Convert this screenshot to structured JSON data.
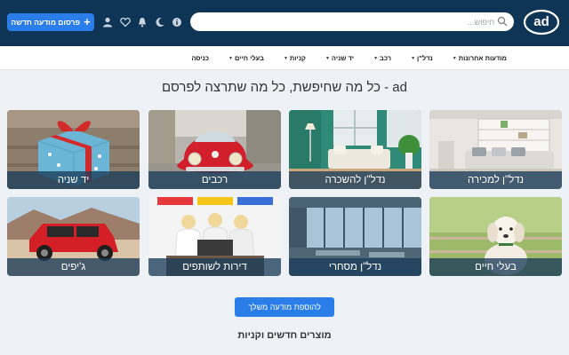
{
  "header": {
    "logo_text": "ad",
    "search_placeholder": "חיפוש...",
    "publish_label": "פרסום מודעה חדשה",
    "publish_icon": "plus-icon",
    "icons": [
      "info-icon",
      "moon-icon",
      "bell-icon",
      "heart-icon",
      "user-icon"
    ]
  },
  "nav": {
    "items": [
      {
        "label": "מודעות אחרונות",
        "dropdown": true
      },
      {
        "label": "נדל\"ן",
        "dropdown": true
      },
      {
        "label": "רכב",
        "dropdown": true
      },
      {
        "label": "יד שניה",
        "dropdown": true
      },
      {
        "label": "קניות",
        "dropdown": true
      },
      {
        "label": "בעלי חיים",
        "dropdown": true
      },
      {
        "label": "כניסה",
        "dropdown": false
      }
    ]
  },
  "main": {
    "headline": "ad - כל מה שחיפשת, כל מה שתרצה לפרסם",
    "categories": [
      {
        "label": "נדל\"ן למכירה",
        "image": "living-room"
      },
      {
        "label": "נדל\"ן להשכרה",
        "image": "green-room"
      },
      {
        "label": "רכבים",
        "image": "red-beetle-car"
      },
      {
        "label": "יד שניה",
        "image": "gift-box"
      },
      {
        "label": "בעלי חיים",
        "image": "white-puppy"
      },
      {
        "label": "נדל\"ן מסחרי",
        "image": "office-space"
      },
      {
        "label": "דירות לשותפים",
        "image": "three-women-laptop"
      },
      {
        "label": "ג'יפים",
        "image": "red-jeep"
      }
    ],
    "add_button": "להוספת מודעה משלך",
    "subheading": "מוצרים חדשים וקניות"
  },
  "colors": {
    "header_bg": "#0f3556",
    "accent": "#2b7de9",
    "page_bg": "#eef1f6",
    "card_label_bg": "#193c5a"
  }
}
